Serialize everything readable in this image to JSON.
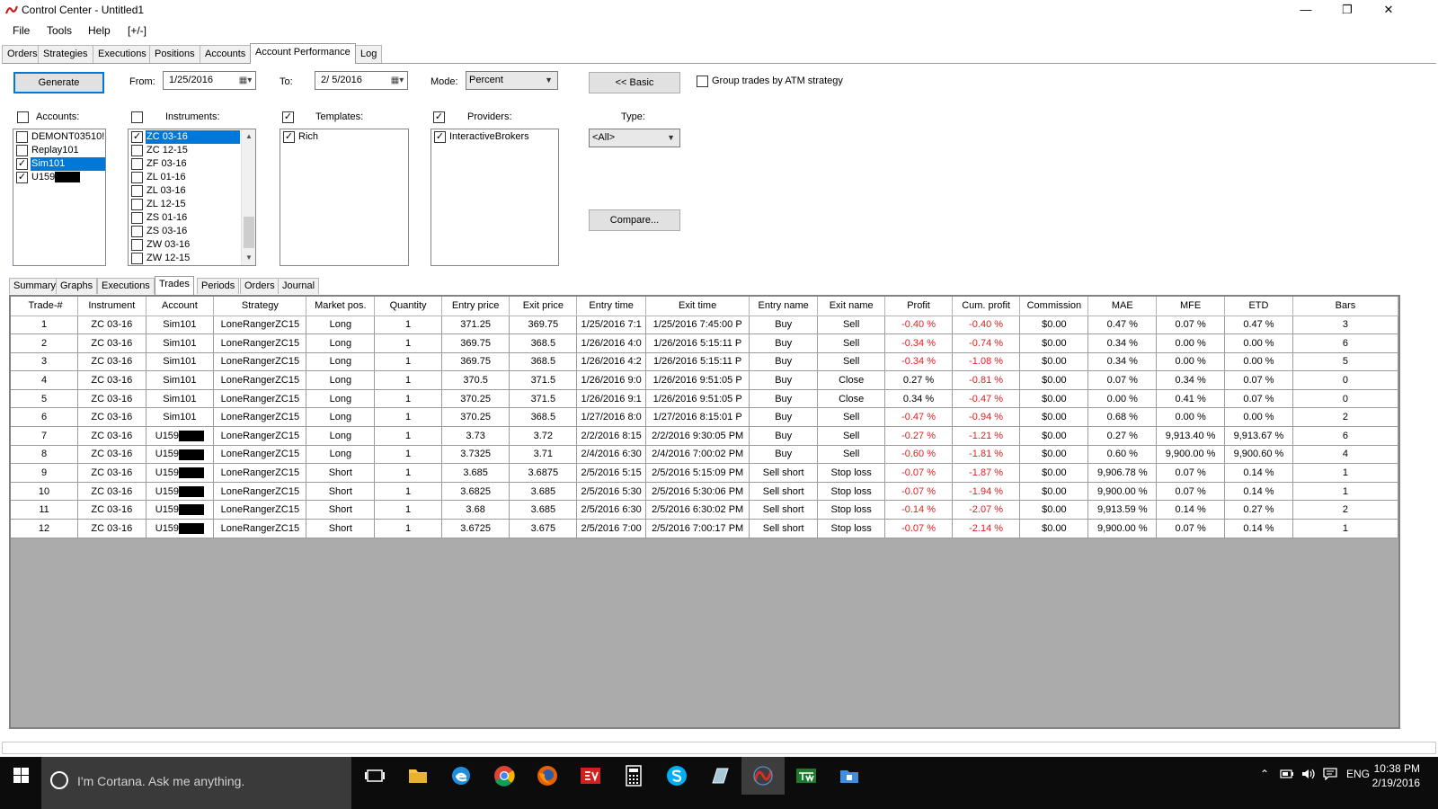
{
  "window": {
    "title": "Control Center - Untitled1"
  },
  "menu": [
    "File",
    "Tools",
    "Help",
    "[+/-]"
  ],
  "top_tabs": [
    "Orders",
    "Strategies",
    "Executions",
    "Positions",
    "Accounts",
    "Account Performance",
    "Log"
  ],
  "toolbar": {
    "generate": "Generate",
    "from_label": "From:",
    "from_value": "1/25/2016",
    "to_label": "To:",
    "to_value": "2/ 5/2016",
    "mode_label": "Mode:",
    "mode_value": "Percent",
    "basic": "<< Basic",
    "group_trades": "Group trades by ATM strategy",
    "compare": "Compare...",
    "type_label": "Type:",
    "type_value": "<All>"
  },
  "accounts": {
    "label": "Accounts:",
    "items": [
      {
        "name": "DEMONT03510!",
        "checked": false
      },
      {
        "name": "Replay101",
        "checked": false
      },
      {
        "name": "Sim101",
        "checked": true,
        "selected": true
      },
      {
        "name": "U159",
        "checked": true,
        "redacted": true
      }
    ]
  },
  "instruments": {
    "label": "Instruments:",
    "items": [
      {
        "name": "ZC 03-16",
        "checked": true,
        "selected": true
      },
      {
        "name": "ZC 12-15",
        "checked": false
      },
      {
        "name": "ZF 03-16",
        "checked": false
      },
      {
        "name": "ZL 01-16",
        "checked": false
      },
      {
        "name": "ZL 03-16",
        "checked": false
      },
      {
        "name": "ZL 12-15",
        "checked": false
      },
      {
        "name": "ZS 01-16",
        "checked": false
      },
      {
        "name": "ZS 03-16",
        "checked": false
      },
      {
        "name": "ZW 03-16",
        "checked": false
      },
      {
        "name": "ZW 12-15",
        "checked": false
      }
    ]
  },
  "templates": {
    "label": "Templates:",
    "items": [
      {
        "name": "Rich",
        "checked": true
      }
    ]
  },
  "providers": {
    "label": "Providers:",
    "items": [
      {
        "name": "InteractiveBrokers",
        "checked": true
      }
    ]
  },
  "bottom_tabs": [
    "Summary",
    "Graphs",
    "Executions",
    "Trades",
    "Periods",
    "Orders",
    "Journal"
  ],
  "table": {
    "columns": [
      "Trade-#",
      "Instrument",
      "Account",
      "Strategy",
      "Market pos.",
      "Quantity",
      "Entry price",
      "Exit price",
      "Entry time",
      "Exit time",
      "Entry name",
      "Exit name",
      "Profit",
      "Cum. profit",
      "Commission",
      "MAE",
      "MFE",
      "ETD",
      "Bars"
    ],
    "rows": [
      [
        "1",
        "ZC 03-16",
        "Sim101",
        "LoneRangerZC15",
        "Long",
        "1",
        "371.25",
        "369.75",
        "1/25/2016 7:1",
        "1/25/2016 7:45:00 P",
        "Buy",
        "Sell",
        "-0.40 %",
        "-0.40 %",
        "$0.00",
        "0.47 %",
        "0.07 %",
        "0.47 %",
        "3"
      ],
      [
        "2",
        "ZC 03-16",
        "Sim101",
        "LoneRangerZC15",
        "Long",
        "1",
        "369.75",
        "368.5",
        "1/26/2016 4:0",
        "1/26/2016 5:15:11 P",
        "Buy",
        "Sell",
        "-0.34 %",
        "-0.74 %",
        "$0.00",
        "0.34 %",
        "0.00 %",
        "0.00 %",
        "6"
      ],
      [
        "3",
        "ZC 03-16",
        "Sim101",
        "LoneRangerZC15",
        "Long",
        "1",
        "369.75",
        "368.5",
        "1/26/2016 4:2",
        "1/26/2016 5:15:11 P",
        "Buy",
        "Sell",
        "-0.34 %",
        "-1.08 %",
        "$0.00",
        "0.34 %",
        "0.00 %",
        "0.00 %",
        "5"
      ],
      [
        "4",
        "ZC 03-16",
        "Sim101",
        "LoneRangerZC15",
        "Long",
        "1",
        "370.5",
        "371.5",
        "1/26/2016 9:0",
        "1/26/2016 9:51:05 P",
        "Buy",
        "Close",
        "0.27 %",
        "-0.81 %",
        "$0.00",
        "0.07 %",
        "0.34 %",
        "0.07 %",
        "0"
      ],
      [
        "5",
        "ZC 03-16",
        "Sim101",
        "LoneRangerZC15",
        "Long",
        "1",
        "370.25",
        "371.5",
        "1/26/2016 9:1",
        "1/26/2016 9:51:05 P",
        "Buy",
        "Close",
        "0.34 %",
        "-0.47 %",
        "$0.00",
        "0.00 %",
        "0.41 %",
        "0.07 %",
        "0"
      ],
      [
        "6",
        "ZC 03-16",
        "Sim101",
        "LoneRangerZC15",
        "Long",
        "1",
        "370.25",
        "368.5",
        "1/27/2016 8:0",
        "1/27/2016 8:15:01 P",
        "Buy",
        "Sell",
        "-0.47 %",
        "-0.94 %",
        "$0.00",
        "0.68 %",
        "0.00 %",
        "0.00 %",
        "2"
      ],
      [
        "7",
        "ZC 03-16",
        "U159",
        "LoneRangerZC15",
        "Long",
        "1",
        "3.73",
        "3.72",
        "2/2/2016 8:15",
        "2/2/2016 9:30:05 PM",
        "Buy",
        "Sell",
        "-0.27 %",
        "-1.21 %",
        "$0.00",
        "0.27 %",
        "9,913.40 %",
        "9,913.67 %",
        "6"
      ],
      [
        "8",
        "ZC 03-16",
        "U159",
        "LoneRangerZC15",
        "Long",
        "1",
        "3.7325",
        "3.71",
        "2/4/2016 6:30",
        "2/4/2016 7:00:02 PM",
        "Buy",
        "Sell",
        "-0.60 %",
        "-1.81 %",
        "$0.00",
        "0.60 %",
        "9,900.00 %",
        "9,900.60 %",
        "4"
      ],
      [
        "9",
        "ZC 03-16",
        "U159",
        "LoneRangerZC15",
        "Short",
        "1",
        "3.685",
        "3.6875",
        "2/5/2016 5:15",
        "2/5/2016 5:15:09 PM",
        "Sell short",
        "Stop loss",
        "-0.07 %",
        "-1.87 %",
        "$0.00",
        "9,906.78 %",
        "0.07 %",
        "0.14 %",
        "1"
      ],
      [
        "10",
        "ZC 03-16",
        "U159",
        "LoneRangerZC15",
        "Short",
        "1",
        "3.6825",
        "3.685",
        "2/5/2016 5:30",
        "2/5/2016 5:30:06 PM",
        "Sell short",
        "Stop loss",
        "-0.07 %",
        "-1.94 %",
        "$0.00",
        "9,900.00 %",
        "0.07 %",
        "0.14 %",
        "1"
      ],
      [
        "11",
        "ZC 03-16",
        "U159",
        "LoneRangerZC15",
        "Short",
        "1",
        "3.68",
        "3.685",
        "2/5/2016 6:30",
        "2/5/2016 6:30:02 PM",
        "Sell short",
        "Stop loss",
        "-0.14 %",
        "-2.07 %",
        "$0.00",
        "9,913.59 %",
        "0.14 %",
        "0.27 %",
        "2"
      ],
      [
        "12",
        "ZC 03-16",
        "U159",
        "LoneRangerZC15",
        "Short",
        "1",
        "3.6725",
        "3.675",
        "2/5/2016 7:00",
        "2/5/2016 7:00:17 PM",
        "Sell short",
        "Stop loss",
        "-0.07 %",
        "-2.14 %",
        "$0.00",
        "9,900.00 %",
        "0.07 %",
        "0.14 %",
        "1"
      ]
    ]
  },
  "taskbar": {
    "search": "I'm Cortana. Ask me anything.",
    "lang": "ENG",
    "time": "10:38 PM",
    "date": "2/19/2016"
  },
  "colors": {
    "negative": "#e02020",
    "selection": "#0078d7",
    "grid_bg": "#ababab"
  }
}
